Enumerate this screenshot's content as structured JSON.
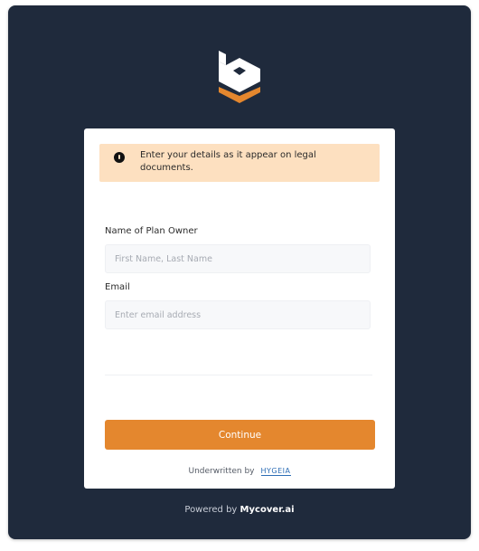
{
  "notice": {
    "text": "Enter your details as it appear on legal documents."
  },
  "form": {
    "owner_label": "Name of Plan Owner",
    "owner_placeholder": "First Name, Last Name",
    "owner_value": "",
    "email_label": "Email",
    "email_placeholder": "Enter email address",
    "email_value": ""
  },
  "continue_label": "Continue",
  "underwritten": {
    "prefix": "Underwritten by",
    "partner": "HYGEIA"
  },
  "footer": {
    "prefix": "Powered by",
    "brand": "Mycover.ai"
  },
  "colors": {
    "background": "#1f2a3c",
    "accent": "#e4872e",
    "notice_bg": "#fde0c0"
  },
  "icons": {
    "brand_logo": "cube-b-logo",
    "notice": "exclamation-circle-icon"
  }
}
